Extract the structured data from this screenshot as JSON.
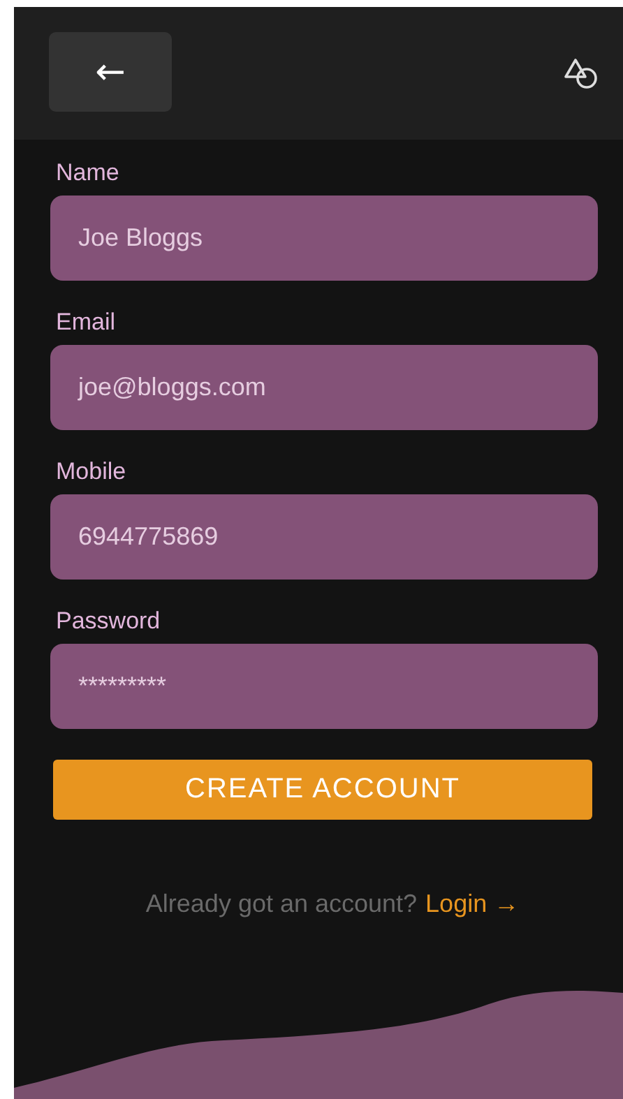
{
  "header": {
    "back_button": "←"
  },
  "fields": [
    {
      "label": "Name",
      "value": "Joe Bloggs"
    },
    {
      "label": "Email",
      "value": "joe@bloggs.com"
    },
    {
      "label": "Mobile",
      "value": "6944775869"
    },
    {
      "label": "Password",
      "value": "*********"
    }
  ],
  "submit_button": "CREATE ACCOUNT",
  "login_prompt": {
    "text": "Already got an account?",
    "link": "Login →"
  }
}
